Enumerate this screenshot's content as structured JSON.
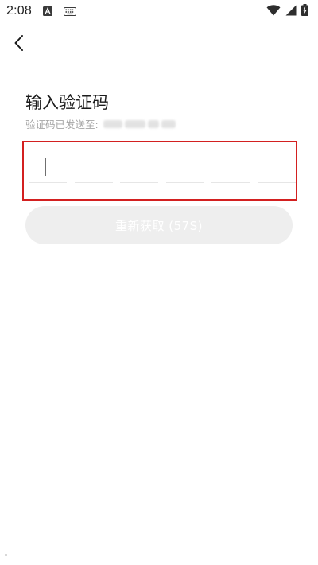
{
  "status_bar": {
    "time": "2:08",
    "icons": [
      "notification-app-icon",
      "keyboard-icon",
      "wifi-icon",
      "signal-icon",
      "battery-charging-icon"
    ]
  },
  "header": {
    "back_icon": "chevron-left-icon"
  },
  "main": {
    "title": "输入验证码",
    "sent_to_label": "验证码已发送至:",
    "code_length": 6,
    "resend_button_label": "重新获取 (57S)"
  },
  "colors": {
    "highlight_border": "#d32020",
    "button_disabled_bg": "#eeeeee",
    "muted_text": "#a6a6a6"
  }
}
